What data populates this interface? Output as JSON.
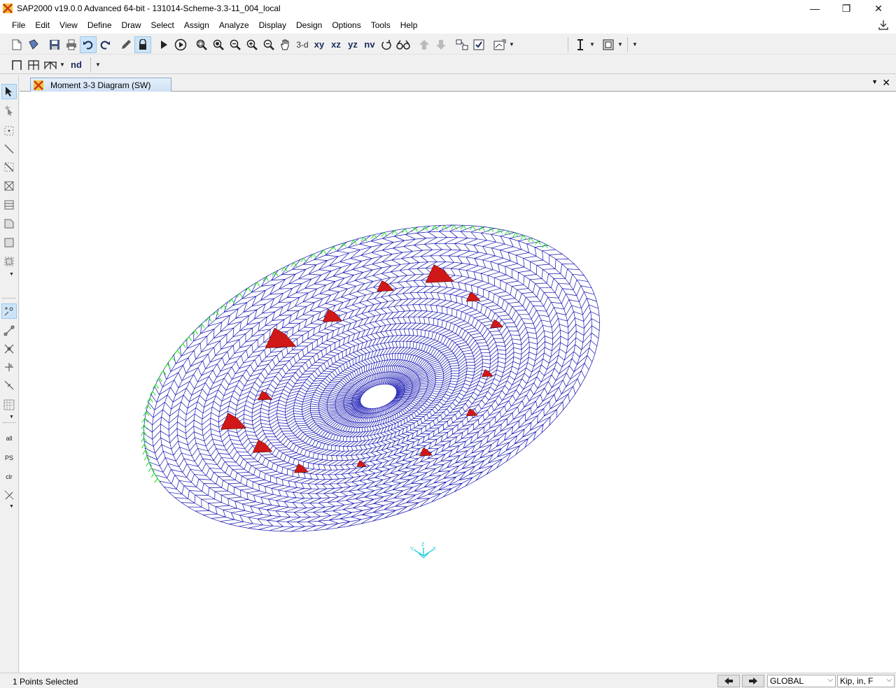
{
  "window": {
    "title": "SAP2000 v19.0.0 Advanced 64-bit - 131014-Scheme-3.3-11_004_local",
    "minimize_glyph": "—",
    "restore_glyph": "❐",
    "close_glyph": "✕"
  },
  "menu": [
    "File",
    "Edit",
    "View",
    "Define",
    "Draw",
    "Select",
    "Assign",
    "Analyze",
    "Display",
    "Design",
    "Options",
    "Tools",
    "Help"
  ],
  "toolbar": {
    "view_3d_label": "3-d",
    "view_xy_label": "xy",
    "view_xz_label": "xz",
    "view_yz_label": "yz",
    "view_nv_label": "nv",
    "nd_label": "nd"
  },
  "palette": {
    "select_all_label": "all",
    "previous_selection_label": "PS",
    "clear_selection_label": "clr"
  },
  "document": {
    "tab_title": "Moment 3-3 Diagram (SW)",
    "axis_labels": {
      "x": "X",
      "y": "Y",
      "z": "Z"
    }
  },
  "status": {
    "selection_text": "1 Points Selected",
    "coord_system": "GLOBAL",
    "units": "Kip, in, F"
  },
  "colors": {
    "mesh": "#1010b0",
    "moment_diagram": "#d01818",
    "restraints": "#18e018",
    "axes": "#00c8d8",
    "app_icon": "#e07820"
  },
  "icons": {
    "app": "sap2000-logo-icon",
    "download": "download-icon"
  }
}
